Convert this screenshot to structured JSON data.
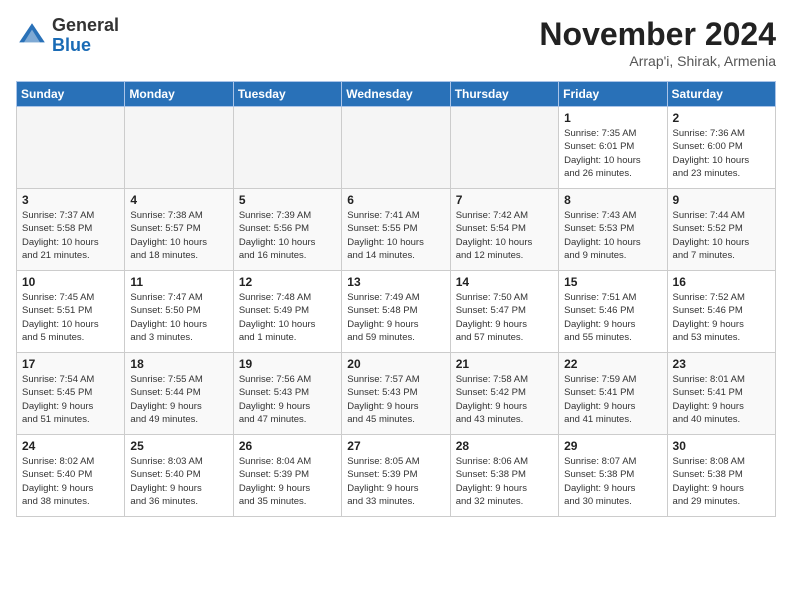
{
  "header": {
    "logo_general": "General",
    "logo_blue": "Blue",
    "month_title": "November 2024",
    "location": "Arrap'i, Shirak, Armenia"
  },
  "weekdays": [
    "Sunday",
    "Monday",
    "Tuesday",
    "Wednesday",
    "Thursday",
    "Friday",
    "Saturday"
  ],
  "weeks": [
    [
      {
        "day": "",
        "info": ""
      },
      {
        "day": "",
        "info": ""
      },
      {
        "day": "",
        "info": ""
      },
      {
        "day": "",
        "info": ""
      },
      {
        "day": "",
        "info": ""
      },
      {
        "day": "1",
        "info": "Sunrise: 7:35 AM\nSunset: 6:01 PM\nDaylight: 10 hours\nand 26 minutes."
      },
      {
        "day": "2",
        "info": "Sunrise: 7:36 AM\nSunset: 6:00 PM\nDaylight: 10 hours\nand 23 minutes."
      }
    ],
    [
      {
        "day": "3",
        "info": "Sunrise: 7:37 AM\nSunset: 5:58 PM\nDaylight: 10 hours\nand 21 minutes."
      },
      {
        "day": "4",
        "info": "Sunrise: 7:38 AM\nSunset: 5:57 PM\nDaylight: 10 hours\nand 18 minutes."
      },
      {
        "day": "5",
        "info": "Sunrise: 7:39 AM\nSunset: 5:56 PM\nDaylight: 10 hours\nand 16 minutes."
      },
      {
        "day": "6",
        "info": "Sunrise: 7:41 AM\nSunset: 5:55 PM\nDaylight: 10 hours\nand 14 minutes."
      },
      {
        "day": "7",
        "info": "Sunrise: 7:42 AM\nSunset: 5:54 PM\nDaylight: 10 hours\nand 12 minutes."
      },
      {
        "day": "8",
        "info": "Sunrise: 7:43 AM\nSunset: 5:53 PM\nDaylight: 10 hours\nand 9 minutes."
      },
      {
        "day": "9",
        "info": "Sunrise: 7:44 AM\nSunset: 5:52 PM\nDaylight: 10 hours\nand 7 minutes."
      }
    ],
    [
      {
        "day": "10",
        "info": "Sunrise: 7:45 AM\nSunset: 5:51 PM\nDaylight: 10 hours\nand 5 minutes."
      },
      {
        "day": "11",
        "info": "Sunrise: 7:47 AM\nSunset: 5:50 PM\nDaylight: 10 hours\nand 3 minutes."
      },
      {
        "day": "12",
        "info": "Sunrise: 7:48 AM\nSunset: 5:49 PM\nDaylight: 10 hours\nand 1 minute."
      },
      {
        "day": "13",
        "info": "Sunrise: 7:49 AM\nSunset: 5:48 PM\nDaylight: 9 hours\nand 59 minutes."
      },
      {
        "day": "14",
        "info": "Sunrise: 7:50 AM\nSunset: 5:47 PM\nDaylight: 9 hours\nand 57 minutes."
      },
      {
        "day": "15",
        "info": "Sunrise: 7:51 AM\nSunset: 5:46 PM\nDaylight: 9 hours\nand 55 minutes."
      },
      {
        "day": "16",
        "info": "Sunrise: 7:52 AM\nSunset: 5:46 PM\nDaylight: 9 hours\nand 53 minutes."
      }
    ],
    [
      {
        "day": "17",
        "info": "Sunrise: 7:54 AM\nSunset: 5:45 PM\nDaylight: 9 hours\nand 51 minutes."
      },
      {
        "day": "18",
        "info": "Sunrise: 7:55 AM\nSunset: 5:44 PM\nDaylight: 9 hours\nand 49 minutes."
      },
      {
        "day": "19",
        "info": "Sunrise: 7:56 AM\nSunset: 5:43 PM\nDaylight: 9 hours\nand 47 minutes."
      },
      {
        "day": "20",
        "info": "Sunrise: 7:57 AM\nSunset: 5:43 PM\nDaylight: 9 hours\nand 45 minutes."
      },
      {
        "day": "21",
        "info": "Sunrise: 7:58 AM\nSunset: 5:42 PM\nDaylight: 9 hours\nand 43 minutes."
      },
      {
        "day": "22",
        "info": "Sunrise: 7:59 AM\nSunset: 5:41 PM\nDaylight: 9 hours\nand 41 minutes."
      },
      {
        "day": "23",
        "info": "Sunrise: 8:01 AM\nSunset: 5:41 PM\nDaylight: 9 hours\nand 40 minutes."
      }
    ],
    [
      {
        "day": "24",
        "info": "Sunrise: 8:02 AM\nSunset: 5:40 PM\nDaylight: 9 hours\nand 38 minutes."
      },
      {
        "day": "25",
        "info": "Sunrise: 8:03 AM\nSunset: 5:40 PM\nDaylight: 9 hours\nand 36 minutes."
      },
      {
        "day": "26",
        "info": "Sunrise: 8:04 AM\nSunset: 5:39 PM\nDaylight: 9 hours\nand 35 minutes."
      },
      {
        "day": "27",
        "info": "Sunrise: 8:05 AM\nSunset: 5:39 PM\nDaylight: 9 hours\nand 33 minutes."
      },
      {
        "day": "28",
        "info": "Sunrise: 8:06 AM\nSunset: 5:38 PM\nDaylight: 9 hours\nand 32 minutes."
      },
      {
        "day": "29",
        "info": "Sunrise: 8:07 AM\nSunset: 5:38 PM\nDaylight: 9 hours\nand 30 minutes."
      },
      {
        "day": "30",
        "info": "Sunrise: 8:08 AM\nSunset: 5:38 PM\nDaylight: 9 hours\nand 29 minutes."
      }
    ]
  ]
}
